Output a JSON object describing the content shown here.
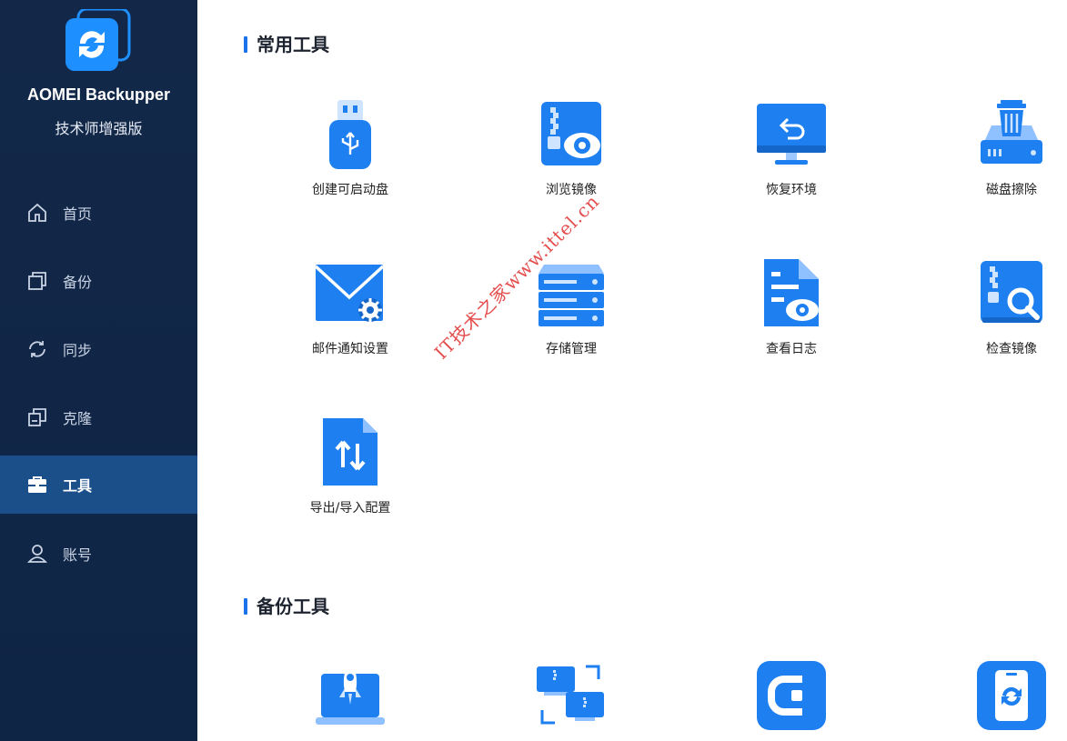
{
  "app": {
    "name": "AOMEI Backupper",
    "edition": "技术师增强版"
  },
  "sidebar": {
    "items": [
      {
        "label": "首页",
        "icon": "home-icon"
      },
      {
        "label": "备份",
        "icon": "backup-icon"
      },
      {
        "label": "同步",
        "icon": "sync-icon"
      },
      {
        "label": "克隆",
        "icon": "clone-icon"
      },
      {
        "label": "工具",
        "icon": "toolbox-icon",
        "active": true
      },
      {
        "label": "账号",
        "icon": "user-icon"
      }
    ]
  },
  "sections": {
    "common": {
      "title": "常用工具",
      "tools": [
        {
          "label": "创建可启动盘",
          "icon": "usb-drive-icon"
        },
        {
          "label": "浏览镜像",
          "icon": "explore-image-icon"
        },
        {
          "label": "恢复环境",
          "icon": "recovery-environment-icon"
        },
        {
          "label": "磁盘擦除",
          "icon": "disk-wipe-icon"
        },
        {
          "label": "邮件通知设置",
          "icon": "email-settings-icon"
        },
        {
          "label": "存储管理",
          "icon": "storage-management-icon"
        },
        {
          "label": "查看日志",
          "icon": "view-log-icon"
        },
        {
          "label": "检查镜像",
          "icon": "check-image-icon"
        },
        {
          "label": "导出/导入配置",
          "icon": "export-import-icon"
        }
      ]
    },
    "backup": {
      "title": "备份工具",
      "tools": [
        {
          "icon": "startup-backup-icon"
        },
        {
          "icon": "pc-transfer-icon"
        },
        {
          "icon": "centralized-backup-icon"
        },
        {
          "icon": "phone-backup-icon"
        }
      ]
    }
  },
  "watermark": "IT技术之家www.ittel.cn",
  "colors": {
    "sidebar_bg": "#132849",
    "active_bg": "#1b4f8a",
    "accent": "#1a73e8",
    "icon_blue": "#1e7ff0"
  }
}
